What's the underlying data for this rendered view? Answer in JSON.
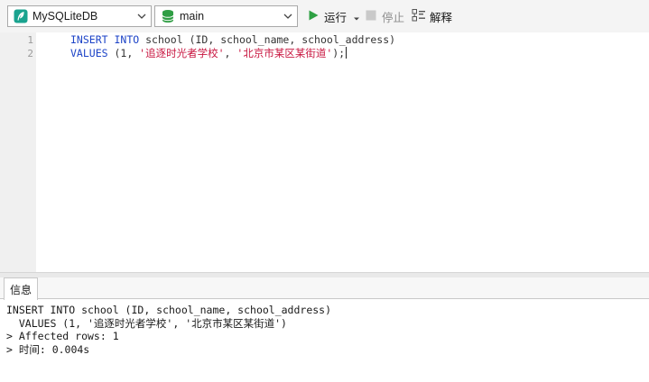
{
  "toolbar": {
    "connection": {
      "value": "MySQLiteDB",
      "icon": "feather-icon"
    },
    "database": {
      "value": "main",
      "icon": "database-icon"
    },
    "run_label": "运行",
    "stop_label": "停止",
    "explain_label": "解释"
  },
  "editor": {
    "line_numbers": [
      "1",
      "2"
    ],
    "line1": {
      "kw1": "INSERT",
      "kw2": "INTO",
      "rest": " school (ID, school_name, school_address)"
    },
    "line2": {
      "kw": "VALUES",
      "open": " (1, ",
      "str1": "'追逐时光者学校'",
      "sep": ", ",
      "str2": "'北京市某区某街道'",
      "close": ");"
    }
  },
  "output": {
    "tab_label": "信息",
    "lines": [
      "INSERT INTO school (ID, school_name, school_address)",
      "  VALUES (1, '追逐时光者学校', '北京市某区某街道')",
      "> Affected rows: 1",
      "> 时间: 0.004s"
    ]
  },
  "colors": {
    "keyword": "#1c43c7",
    "string": "#c8153f",
    "run_green": "#2ea043",
    "db_green": "#2f9e44",
    "feather_teal": "#1aa38f"
  }
}
